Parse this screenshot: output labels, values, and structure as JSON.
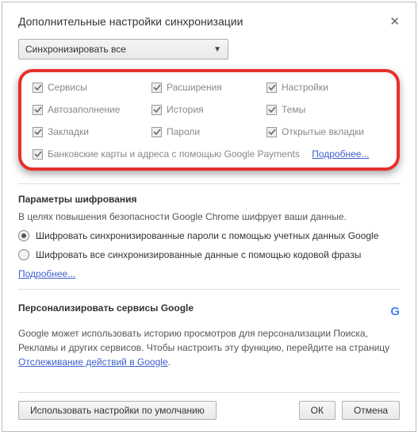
{
  "title": "Дополнительные настройки синхронизации",
  "select": {
    "label": "Синхронизировать все"
  },
  "checkboxes": {
    "row1": [
      "Сервисы",
      "Расширения",
      "Настройки"
    ],
    "row2": [
      "Автозаполнение",
      "История",
      "Темы"
    ],
    "row3": [
      "Закладки",
      "Пароли",
      "Открытые вкладки"
    ],
    "long": "Банковские карты и адреса с помощью Google Payments",
    "long_link": "Подробнее..."
  },
  "encryption": {
    "title": "Параметры шифрования",
    "desc": "В целях повышения безопасности Google Chrome шифрует ваши данные.",
    "opt1": "Шифровать синхронизированные пароли с помощью учетных данных Google",
    "opt2": "Шифровать все синхронизированные данные с помощью кодовой фразы",
    "link": "Подробнее..."
  },
  "google": {
    "title": "Персонализировать сервисы Google",
    "text": "Google может использовать историю просмотров для персонализации Поиска, Рекламы и других сервисов. Чтобы настроить эту функцию, перейдите на страницу ",
    "link": "Отслеживание действий в Google",
    "period": "."
  },
  "footer": {
    "defaults": "Использовать настройки по умолчанию",
    "ok": "ОК",
    "cancel": "Отмена"
  }
}
